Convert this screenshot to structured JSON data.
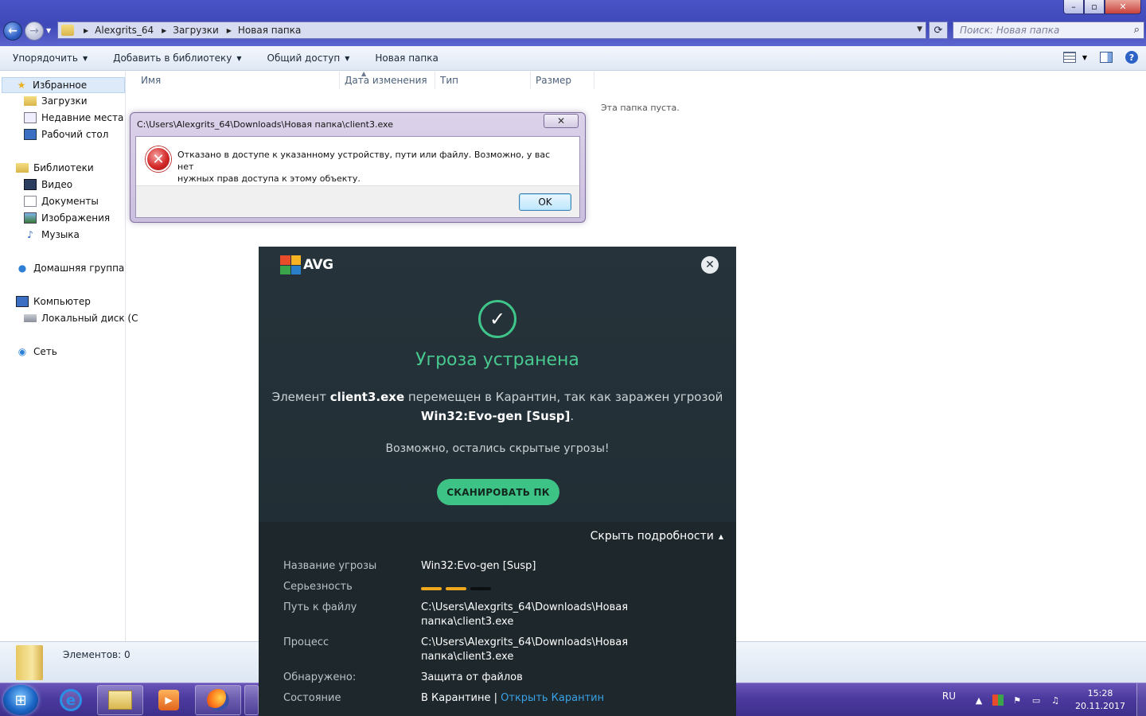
{
  "window": {
    "controls": {
      "minimize": "–",
      "maximize": "▫",
      "close": "✕"
    }
  },
  "address_bar": {
    "crumbs": [
      "Alexgrits_64",
      "Загрузки",
      "Новая папка"
    ],
    "search_placeholder": "Поиск: Новая папка"
  },
  "toolbar": {
    "organize": "Упорядочить",
    "add_to_library": "Добавить в библиотеку",
    "share": "Общий доступ",
    "new_folder": "Новая папка"
  },
  "nav": {
    "favorites": "Избранное",
    "downloads": "Загрузки",
    "recent": "Недавние места",
    "desktop": "Рабочий стол",
    "libraries": "Библиотеки",
    "video": "Видео",
    "documents": "Документы",
    "images": "Изображения",
    "music": "Музыка",
    "homegroup": "Домашняя группа",
    "computer": "Компьютер",
    "local_disk": "Локальный диск (C",
    "network": "Сеть"
  },
  "columns": {
    "name": "Имя",
    "date": "Дата изменения",
    "type": "Тип",
    "size": "Размер"
  },
  "empty_message": "Эта папка пуста.",
  "error_dialog": {
    "title": "C:\\Users\\Alexgrits_64\\Downloads\\Новая папка\\client3.exe",
    "message_line1": "Отказано в доступе к указанному устройству, пути или файлу. Возможно,  у вас нет",
    "message_line2": "нужных прав доступа к этому объекту.",
    "ok": "OK"
  },
  "status": {
    "items": "Элементов: 0"
  },
  "taskbar": {
    "lang": "RU",
    "time": "15:28",
    "date": "20.11.2017"
  },
  "avg": {
    "brand": "AVG",
    "title": "Угроза устранена",
    "line1_pre": "Элемент",
    "file": "client3.exe",
    "line1_post": "перемещен в Карантин, так как заражен угрозой",
    "threat": "Win32:Evo-gen [Susp]",
    "line2_post": ".",
    "hint": "Возможно, остались скрытые угрозы!",
    "scan_button": "СКАНИРОВАТЬ ПК",
    "toggle_details": "Скрыть подробности",
    "details": {
      "threat_name_label": "Название угрозы",
      "threat_name_value": "Win32:Evo-gen [Susp]",
      "severity_label": "Серьезность",
      "severity_level": 2,
      "severity_max": 3,
      "path_label": "Путь к файлу",
      "path_value": "C:\\Users\\Alexgrits_64\\Downloads\\Новая папка\\client3.exe",
      "process_label": "Процесс",
      "process_value": "C:\\Users\\Alexgrits_64\\Downloads\\Новая папка\\client3.exe",
      "detected_label": "Обнаружено:",
      "detected_value": "Защита от файлов",
      "state_label": "Состояние",
      "state_value": "В Карантине |",
      "state_link": "Открыть Карантин"
    },
    "colors": {
      "accent": "#3ec387",
      "severity_on": "#f0a81c",
      "severity_off": "#0b0f11",
      "link": "#3aa2e6"
    }
  }
}
